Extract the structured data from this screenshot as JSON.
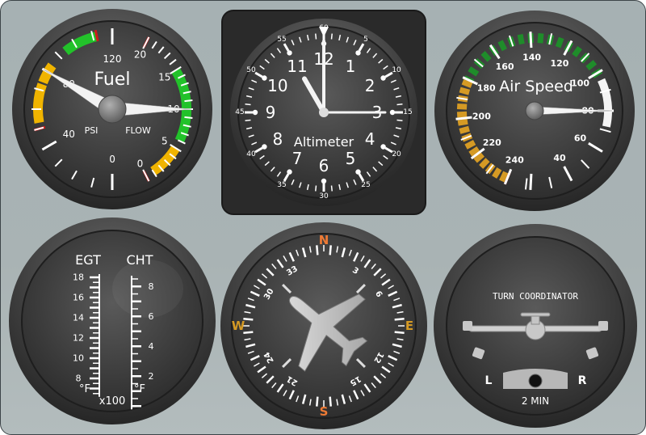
{
  "colors": {
    "panel": "#a9b3b4",
    "bezel": "#3a3a3a",
    "face": "#3d3d3d",
    "white": "#ffffff",
    "green": "#22c22a",
    "yellow": "#f0b400",
    "red": "#cc1a1a",
    "orange": "#e07b2e",
    "compass_cardinal": "#ef7b35",
    "amber": "#d59a24"
  },
  "fuel": {
    "title": "Fuel",
    "psi_label": "PSI",
    "flow_label": "FLOW",
    "psi_ticks": [
      "120",
      "80",
      "40",
      "0"
    ],
    "flow_ticks": [
      "20",
      "15",
      "10",
      "5",
      "0"
    ],
    "psi_value": 80,
    "flow_value": 10
  },
  "altimeter": {
    "title": "Altimeter",
    "hour_numbers": [
      "12",
      "1",
      "2",
      "3",
      "4",
      "5",
      "6",
      "7",
      "8",
      "9",
      "10",
      "11"
    ],
    "minute_labels": [
      "60",
      "5",
      "10",
      "15",
      "20",
      "25",
      "30",
      "35",
      "40",
      "45",
      "50",
      "55"
    ],
    "time": "11:00:15"
  },
  "airspeed": {
    "title": "Air Speed",
    "ticks": [
      "240",
      "220",
      "200",
      "180",
      "160",
      "140",
      "120",
      "100",
      "80",
      "60",
      "40"
    ],
    "value": 80
  },
  "egt_cht": {
    "egt_label": "EGT",
    "cht_label": "CHT",
    "egt_ticks": [
      "18",
      "16",
      "14",
      "12",
      "10",
      "8"
    ],
    "cht_ticks": [
      "8",
      "6",
      "4",
      "2"
    ],
    "unit_left": "°F",
    "unit_right": "°F",
    "multiplier": "x100"
  },
  "compass": {
    "north": "N",
    "east": "E",
    "south": "S",
    "west": "W",
    "headings": [
      "3",
      "6",
      "12",
      "15",
      "21",
      "24",
      "30",
      "33"
    ],
    "heading_value": 315
  },
  "turn": {
    "title": "TURN COORDINATOR",
    "left": "L",
    "right": "R",
    "time": "2 MIN"
  }
}
